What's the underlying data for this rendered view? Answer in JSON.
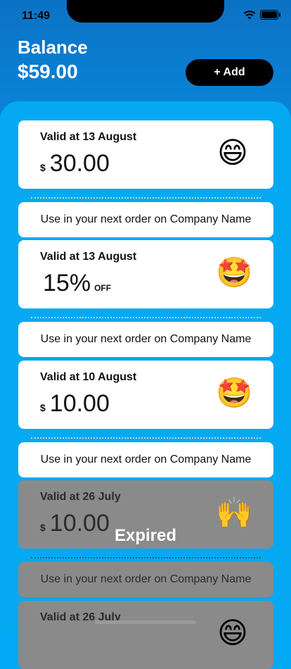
{
  "status_bar": {
    "time": "11:49",
    "icons": [
      "wifi-icon",
      "battery-icon"
    ]
  },
  "header": {
    "title": "Balance",
    "amount": "$59.00",
    "add_label": "+ Add"
  },
  "coupons": [
    {
      "valid": "Valid at 13 August",
      "currency": "$",
      "amount": "30.00",
      "emoji": "😄",
      "note": "Use in your next order on Company Name",
      "expired": false
    },
    {
      "valid": "Valid at 13 August",
      "percent": "15%",
      "off": "OFF",
      "emoji": "🤩",
      "note": "Use in your next order on Company Name",
      "expired": false
    },
    {
      "valid": "Valid at 10 August",
      "currency": "$",
      "amount": "10.00",
      "emoji": "🤩",
      "note": "Use in your next order on Company Name",
      "expired": false
    },
    {
      "valid": "Valid at 26 July",
      "currency": "$",
      "amount": "10.00",
      "emoji": "🙌",
      "note": "Use in your next order on Company Name",
      "expired": true,
      "expired_label": "Expired"
    },
    {
      "valid": "Valid at 26 July",
      "emoji": "😄",
      "expired": true
    }
  ],
  "colors": {
    "accent": "#03a9f4",
    "header": "#0b7ed2",
    "card": "#ffffff",
    "expired_card": "#8a8a8a"
  }
}
